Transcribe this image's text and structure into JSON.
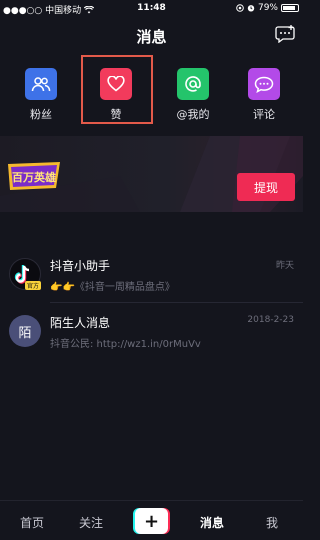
{
  "status_bar": {
    "carrier": "●●●○○ 中国移动",
    "time": "11:48",
    "battery": "79%"
  },
  "header": {
    "title": "消息"
  },
  "quick_actions": [
    {
      "label": "粉丝",
      "icon": "fans-icon",
      "color": "#3e72e8"
    },
    {
      "label": "赞",
      "icon": "heart-icon",
      "color": "#f23b5c"
    },
    {
      "label": "@我的",
      "icon": "at-icon",
      "color": "#24c46b"
    },
    {
      "label": "评论",
      "icon": "comment-icon",
      "color": "#b34ae8"
    }
  ],
  "banner": {
    "logo_text": "百万英雄",
    "button_label": "提现"
  },
  "messages": [
    {
      "title": "抖音小助手",
      "avatar_badge": "官方",
      "subtitle": "👉👉《抖音一周精品盘点》",
      "time": "昨天"
    },
    {
      "title": "陌生人消息",
      "avatar_text": "陌",
      "subtitle": "抖音公民: http://wz1.in/0rMuVv",
      "time": "2018-2-23"
    }
  ],
  "tabs": [
    {
      "label": "首页",
      "active": false
    },
    {
      "label": "关注",
      "active": false
    },
    {
      "label": "消息",
      "active": true
    },
    {
      "label": "我",
      "active": false
    }
  ],
  "colors": {
    "background": "#14151d",
    "accent": "#ef2b54",
    "highlight_box": "#e35a4a"
  }
}
